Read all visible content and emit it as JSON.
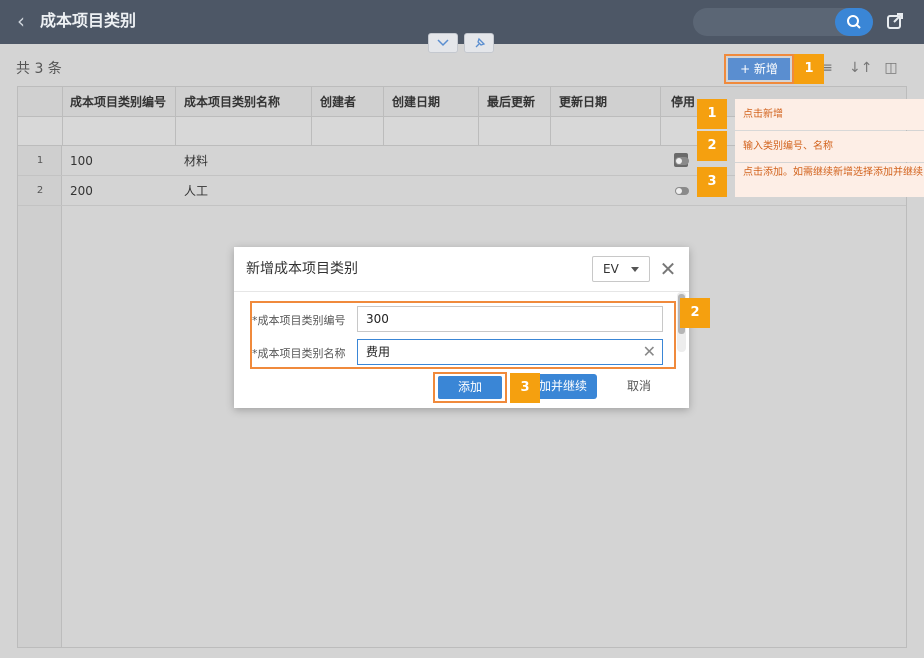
{
  "header": {
    "title": "成本项目类别"
  },
  "toolbar": {
    "count_text": "共 3 条",
    "add_label": "+ 新增"
  },
  "table": {
    "columns": [
      "成本项目类别编号",
      "成本项目类别名称",
      "创建者",
      "创建日期",
      "最后更新",
      "更新日期",
      "停用"
    ],
    "rows": [
      {
        "no": "1",
        "code": "100",
        "name": "材料"
      },
      {
        "no": "2",
        "code": "200",
        "name": "人工"
      }
    ]
  },
  "dialog": {
    "title": "新增成本项目类别",
    "lang": "EV",
    "fields": [
      {
        "label": "*成本项目类别编号",
        "value": "300"
      },
      {
        "label": "*成本项目类别名称",
        "value": "费用"
      }
    ],
    "add_label": "添加",
    "add_continue_label": "加并继续",
    "cancel_label": "取消"
  },
  "guide": {
    "steps": [
      {
        "num": "1",
        "text": "点击新增"
      },
      {
        "num": "2",
        "text": "输入类别编号、名称"
      },
      {
        "num": "3",
        "text": "点击添加。如需继续新增选择添加并继续"
      }
    ]
  },
  "colors": {
    "accent": "#3a86d6",
    "highlight": "#f08a3c",
    "badge": "#f5a00f",
    "tip_bg": "#fdeee6"
  }
}
